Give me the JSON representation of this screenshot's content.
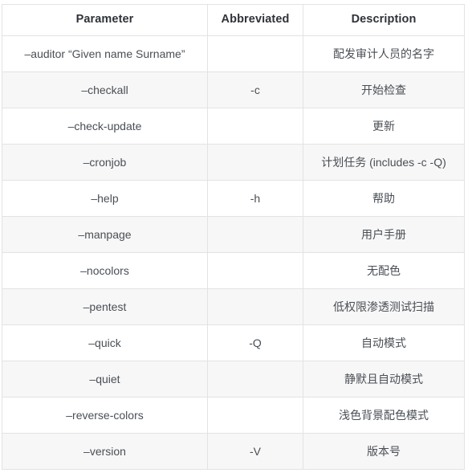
{
  "table": {
    "columns": [
      {
        "key": "parameter",
        "label": "Parameter"
      },
      {
        "key": "abbreviated",
        "label": "Abbreviated"
      },
      {
        "key": "description",
        "label": "Description"
      }
    ],
    "rows": [
      {
        "parameter": "–auditor “Given name Surname”",
        "abbreviated": "",
        "description": "配发审计人员的名字"
      },
      {
        "parameter": "–checkall",
        "abbreviated": "-c",
        "description": "开始检查"
      },
      {
        "parameter": "–check-update",
        "abbreviated": "",
        "description": "更新"
      },
      {
        "parameter": "–cronjob",
        "abbreviated": "",
        "description": "计划任务 (includes -c -Q)"
      },
      {
        "parameter": "–help",
        "abbreviated": "-h",
        "description": "帮助"
      },
      {
        "parameter": "–manpage",
        "abbreviated": "",
        "description": "用户手册"
      },
      {
        "parameter": "–nocolors",
        "abbreviated": "",
        "description": "无配色"
      },
      {
        "parameter": "–pentest",
        "abbreviated": "",
        "description": "低权限渗透测试扫描"
      },
      {
        "parameter": "–quick",
        "abbreviated": "-Q",
        "description": "自动模式"
      },
      {
        "parameter": "–quiet",
        "abbreviated": "",
        "description": "静默且自动模式"
      },
      {
        "parameter": "–reverse-colors",
        "abbreviated": "",
        "description": "浅色背景配色模式"
      },
      {
        "parameter": "–version",
        "abbreviated": "-V",
        "description": "版本号"
      }
    ]
  },
  "colors": {
    "border": "#e3e3e3",
    "row_stripe": "#f7f7f7",
    "row_base": "#ffffff",
    "header_text": "#2f3338",
    "body_text": "#4a4f55"
  }
}
